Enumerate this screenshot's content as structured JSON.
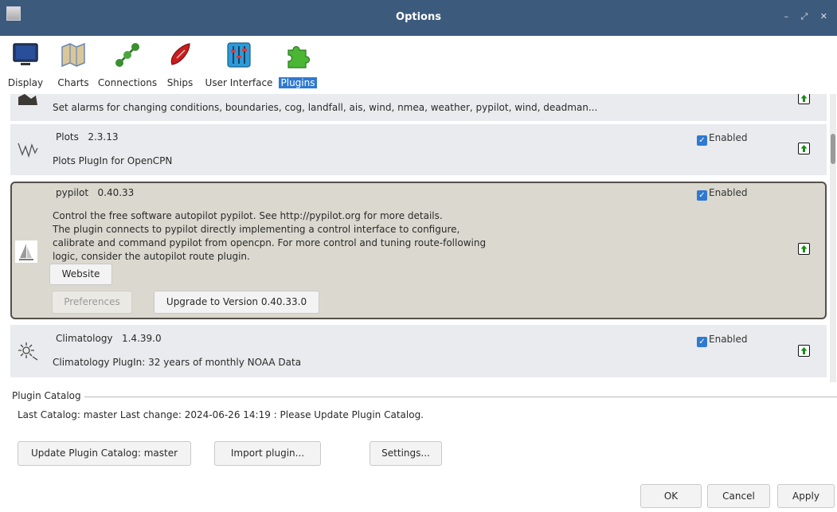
{
  "window": {
    "title": "Options",
    "controls": "– ⤢ ✕"
  },
  "tabs": [
    {
      "label": "Display",
      "icon": "display-icon"
    },
    {
      "label": "Charts",
      "icon": "charts-icon"
    },
    {
      "label": "Connections",
      "icon": "connections-icon"
    },
    {
      "label": "Ships",
      "icon": "ships-icon"
    },
    {
      "label": "User Interface",
      "icon": "user-interface-icon"
    },
    {
      "label": "Plugins",
      "icon": "plugins-icon",
      "active": true
    }
  ],
  "plugins": {
    "watchdog": {
      "desc": "Set alarms for changing conditions, boundaries, cog, landfall, ais, wind, nmea, weather, pypilot, wind, deadman..."
    },
    "plots": {
      "name": "Plots",
      "version": "2.3.13",
      "desc": "Plots PlugIn for OpenCPN",
      "enabled": "Enabled"
    },
    "pypilot": {
      "name": "pypilot",
      "version": "0.40.33",
      "desc_lines": [
        "Control the free software autopilot pypilot. See http://pypilot.org for more details.",
        "The plugin connects to pypilot directly implementing a control interface to configure,",
        "calibrate and command pypilot from opencpn. For more control and tuning route-following",
        "logic, consider the autopilot route plugin."
      ],
      "enabled": "Enabled",
      "website": "Website",
      "preferences": "Preferences",
      "upgrade": "Upgrade to Version 0.40.33.0"
    },
    "climatology": {
      "name": "Climatology",
      "version": "1.4.39.0",
      "desc": "Climatology PlugIn: 32 years of monthly NOAA Data",
      "enabled": "Enabled"
    }
  },
  "catalog": {
    "legend": "Plugin Catalog",
    "last": "Last Catalog: master  Last change:  2024-06-26 14:19  : Please Update Plugin Catalog.",
    "update_btn": "Update Plugin Catalog: master",
    "import_btn": "Import plugin...",
    "settings_btn": "Settings..."
  },
  "footer": {
    "ok": "OK",
    "cancel": "Cancel",
    "apply": "Apply"
  },
  "colors": {
    "titlebar": "#3c5a7c",
    "accent": "#2f79d1",
    "selected_bg": "#dbd8cf",
    "row_bg": "#e9ebee"
  }
}
